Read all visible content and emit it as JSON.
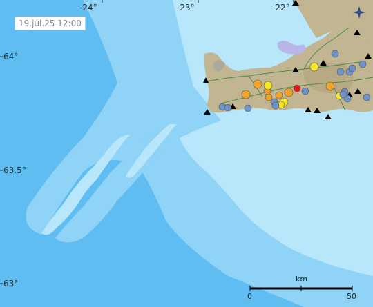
{
  "timestamp": "19.júl.25 12:00",
  "axes": {
    "longitude_labels": [
      "-24°",
      "-23°",
      "-22°"
    ],
    "latitude_labels": [
      "64°",
      "63.5°",
      "63°"
    ]
  },
  "scale_bar": {
    "unit": "km",
    "start": "0",
    "end": "50"
  },
  "icons": {
    "compass": "compass-rose-icon",
    "volcano": "triangle-marker-icon"
  },
  "colors": {
    "deep_sea": "#5fbdf2",
    "mid_sea": "#8fd3f7",
    "shelf_sea": "#b8e7fb",
    "land": "#c2b591",
    "lava": "#a3a3a3",
    "lake": "#b8b6e8",
    "quake_red": "#e6151c",
    "quake_orange": "#f1a42a",
    "quake_yellow": "#f5e62c",
    "quake_blue": "#6f92c9",
    "station": "#000000"
  },
  "earthquakes": [
    {
      "color": "red",
      "size": 5
    },
    {
      "color": "orange",
      "size": 6
    },
    {
      "color": "orange",
      "size": 6
    },
    {
      "color": "orange",
      "size": 6
    },
    {
      "color": "orange",
      "size": 6
    },
    {
      "color": "orange",
      "size": 5
    },
    {
      "color": "orange",
      "size": 5
    },
    {
      "color": "orange",
      "size": 5
    },
    {
      "color": "yellow",
      "size": 6
    },
    {
      "color": "yellow",
      "size": 6
    },
    {
      "color": "yellow",
      "size": 6
    },
    {
      "color": "yellow",
      "size": 5
    },
    {
      "color": "yellow",
      "size": 5
    },
    {
      "color": "blue",
      "size": 5
    },
    {
      "color": "blue",
      "size": 5
    },
    {
      "color": "blue",
      "size": 5
    },
    {
      "color": "blue",
      "size": 5
    },
    {
      "color": "blue",
      "size": 5
    },
    {
      "color": "blue",
      "size": 5
    },
    {
      "color": "blue",
      "size": 5
    },
    {
      "color": "blue",
      "size": 5
    },
    {
      "color": "blue",
      "size": 5
    },
    {
      "color": "blue",
      "size": 5
    },
    {
      "color": "blue",
      "size": 5
    },
    {
      "color": "blue",
      "size": 5
    },
    {
      "color": "blue",
      "size": 5
    },
    {
      "color": "blue",
      "size": 5
    },
    {
      "color": "blue",
      "size": 5
    }
  ],
  "stations_count": 14
}
